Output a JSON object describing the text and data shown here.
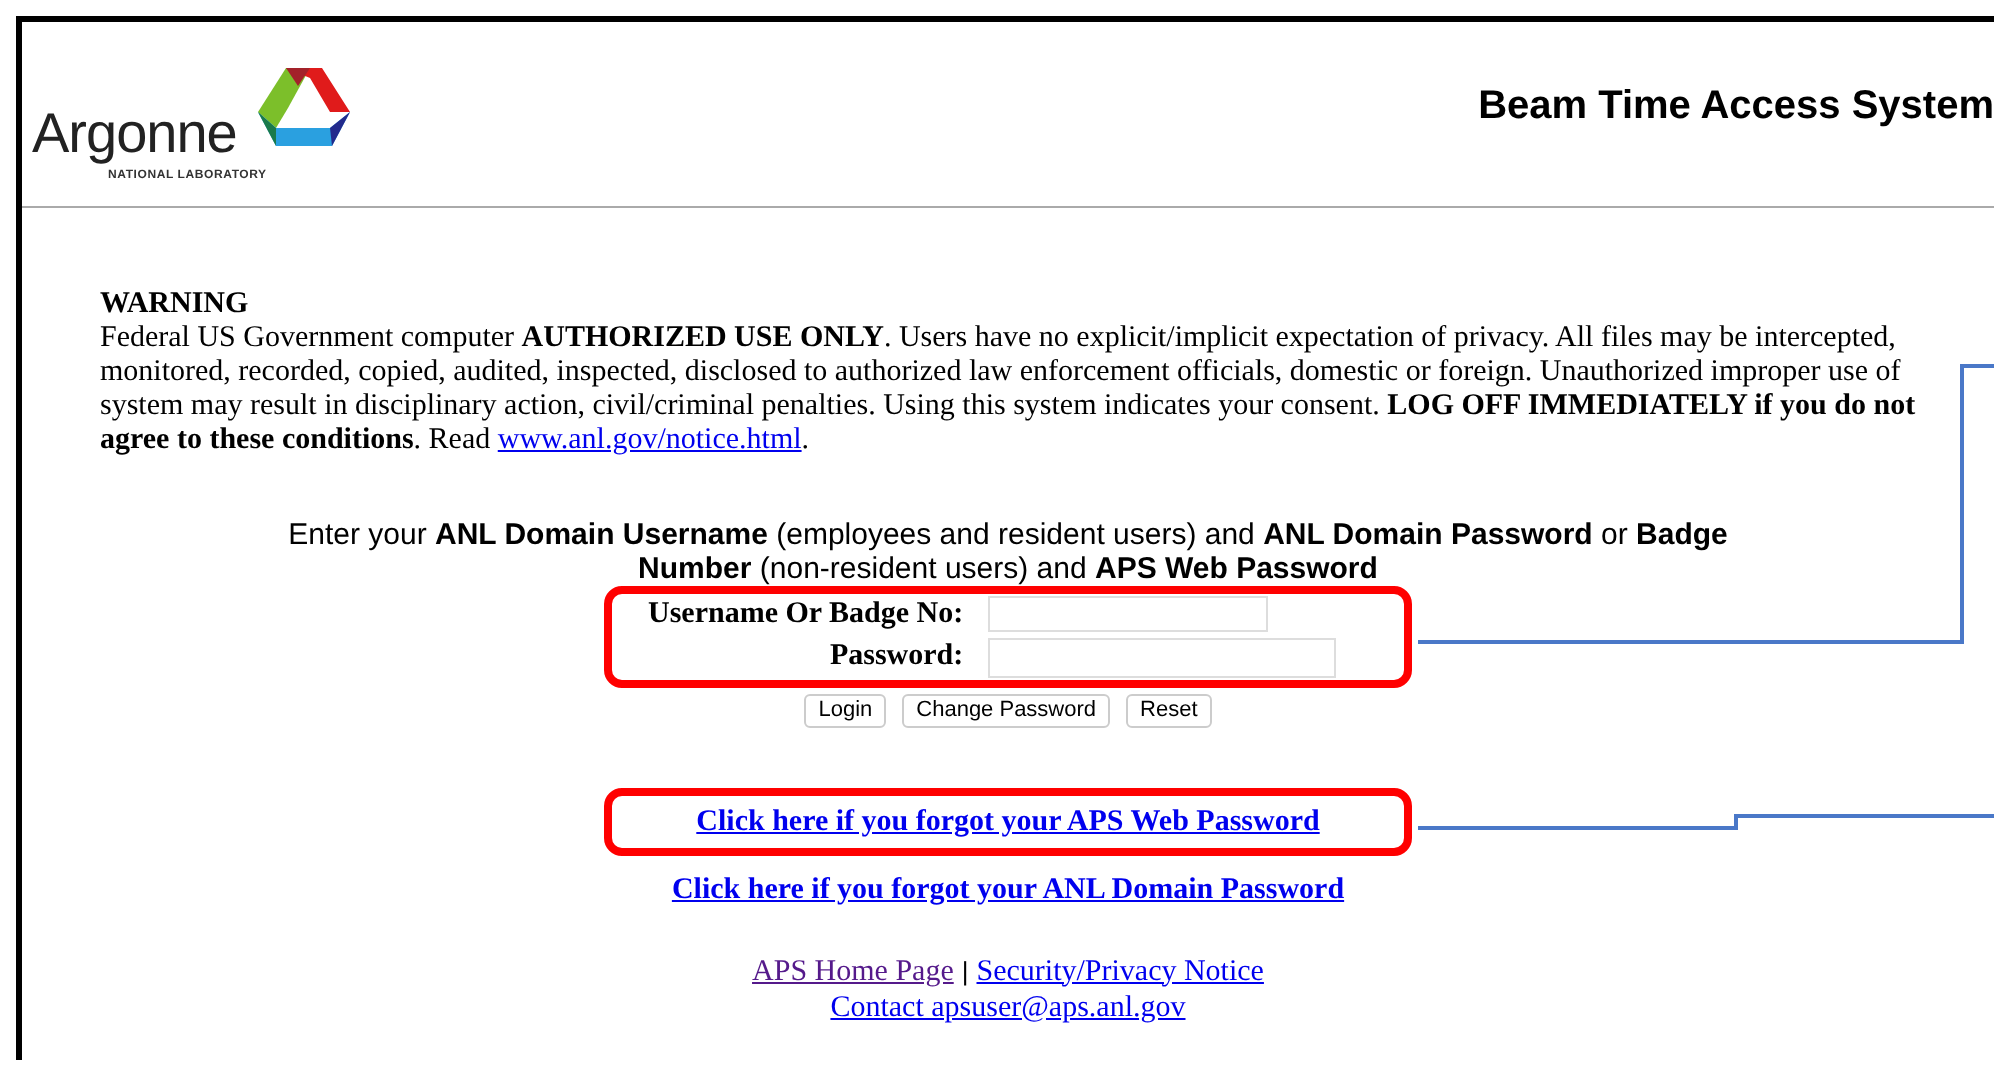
{
  "header": {
    "logo": {
      "name": "Argonne",
      "tagline": "NATIONAL LABORATORY"
    },
    "title": "Beam Time Access System"
  },
  "warning": {
    "heading": "WARNING",
    "body": "Federal US Government computer **AUTHORIZED USE ONLY**. Users have no explicit/implicit expectation of privacy. All files may be intercepted, monitored, recorded, copied, audited, inspected, disclosed to authorized law enforcement officials, domestic or foreign. Unauthorized improper use of system may result in disciplinary action, civil/criminal penalties. Using this system indicates your consent. **LOG OFF IMMEDIATELY if you do not agree to these conditions**. Read",
    "link": "www.anl.gov/notice.html",
    "end": "."
  },
  "instructions": "Enter your **ANL Domain Username** (employees and resident users) and **ANL Domain Password** or **Badge Number** (non-resident users) and **APS Web Password**",
  "login_form": {
    "highlighted": true,
    "fields": [
      {
        "label": "Username Or Badge No:",
        "kind": "text"
      },
      {
        "label": "Password:",
        "kind": "password"
      }
    ],
    "buttons": [
      "Login",
      "Change Password",
      "Reset"
    ]
  },
  "links": [
    {
      "text": "Click here if you forgot your APS Web Password",
      "highlighted": true
    },
    {
      "text": "Click here if you forgot your ANL Domain Password",
      "highlighted": false
    }
  ],
  "footer": {
    "links": [
      {
        "text": "APS Home Page",
        "visited": true
      },
      {
        "text": "Security/Privacy Notice",
        "visited": false
      }
    ],
    "separator": "|",
    "contact": "Contact apsuser@aps.anl.gov"
  }
}
